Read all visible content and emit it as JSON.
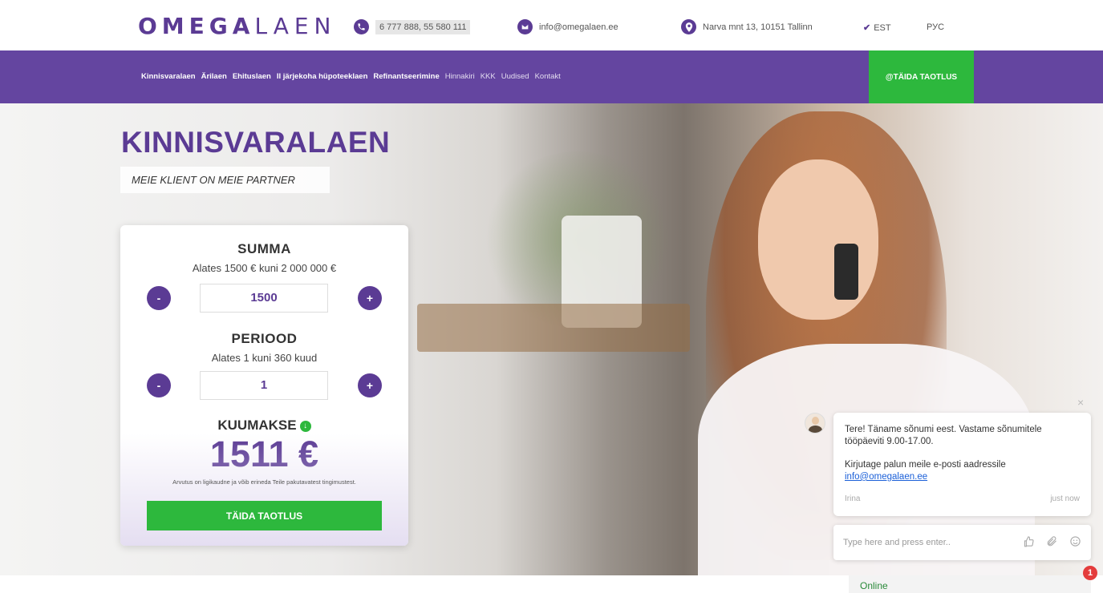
{
  "header": {
    "logo_bold": "OMEGA",
    "logo_light": "LAEN",
    "phone": "6 777 888, 55 580 111",
    "email": "info@omegalaen.ee",
    "address": "Narva mnt 13, 10151 Tallinn",
    "languages": [
      {
        "label": "EST",
        "selected": true
      },
      {
        "label": "РУС",
        "selected": false
      }
    ]
  },
  "nav": {
    "items": [
      {
        "label": "Kinnisvaralaen",
        "bold": true
      },
      {
        "label": "Ärilaen",
        "bold": true
      },
      {
        "label": "Ehituslaen",
        "bold": true
      },
      {
        "label": "II järjekoha hüpoteeklaen",
        "bold": true
      },
      {
        "label": "Refinantseerimine",
        "bold": true
      },
      {
        "label": "Hinnakiri",
        "bold": false
      },
      {
        "label": "KKK",
        "bold": false
      },
      {
        "label": "Uudised",
        "bold": false
      },
      {
        "label": "Kontakt",
        "bold": false
      }
    ],
    "cta": "@TÄIDA TAOTLUS"
  },
  "hero": {
    "title": "KINNISVARALAEN",
    "tagline": "MEIE KLIENT ON MEIE PARTNER"
  },
  "calculator": {
    "amount": {
      "title": "SUMMA",
      "range": "Alates 1500 € kuni 2 000 000 €",
      "value": "1500",
      "minus": "-",
      "plus": "+"
    },
    "period": {
      "title": "PERIOOD",
      "range": "Alates 1 kuni 360 kuud",
      "value": "1",
      "minus": "-",
      "plus": "+"
    },
    "monthly_label": "KUUMAKSE",
    "monthly_value": "1511 €",
    "disclaimer": "Arvutus on ligikaudne ja võib erineda Teile pakutavatest tingimustest.",
    "submit": "TÄIDA TAOTLUS"
  },
  "chat": {
    "close": "×",
    "message_line1": "Tere! Täname sõnumi eest. Vastame sõnumitele tööpäeviti 9.00-17.00.",
    "message_line2": "Kirjutage palun meile e-posti aadressile",
    "message_email": "info@omegalaen.ee",
    "agent": "Irina",
    "time": "just now",
    "input_placeholder": "Type here and press enter..",
    "status": "Online",
    "unread": "1"
  },
  "colors": {
    "brand_purple": "#6445a0",
    "accent_green": "#2db83d"
  },
  "icons": {
    "phone": "phone-icon",
    "email": "envelope-icon",
    "address": "map-pin-icon",
    "lang_selected": "check-icon",
    "monthly_info": "download-circle-icon",
    "thumbs_up": "thumbs-up-icon",
    "attach": "paperclip-icon",
    "emoji": "smiley-icon"
  }
}
